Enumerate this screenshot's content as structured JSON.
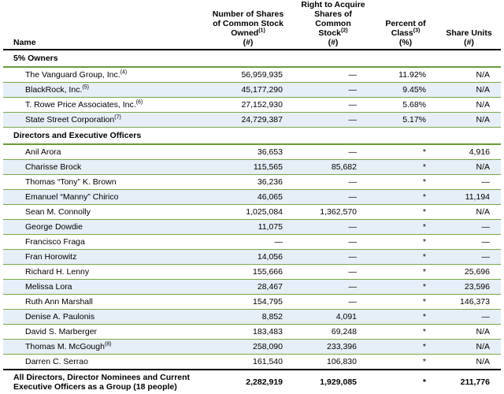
{
  "header": {
    "name": "Name",
    "shares_line1": "Number of Shares",
    "shares_line2": "of Common Stock",
    "shares_line3": "Owned",
    "shares_sup": "(1)",
    "shares_unit": "(#)",
    "right_line1": "Right to Acquire",
    "right_line2": "Shares of Common",
    "right_line3": "Stock",
    "right_sup": "(2)",
    "right_unit": "(#)",
    "pct_line1": "Percent of",
    "pct_line2": "Class",
    "pct_sup": "(3)",
    "pct_unit": "(%)",
    "units_line1": "Share Units",
    "units_unit": "(#)"
  },
  "sections": {
    "owners_title": "5% Owners",
    "directors_title": "Directors and Executive Officers"
  },
  "owners": [
    {
      "name": "The Vanguard Group, Inc.",
      "sup": "(4)",
      "shares": "56,959,935",
      "right": "—",
      "pct": "11.92%",
      "units": "N/A"
    },
    {
      "name": "BlackRock, Inc.",
      "sup": "(5)",
      "shares": "45,177,290",
      "right": "—",
      "pct": "9.45%",
      "units": "N/A"
    },
    {
      "name": "T. Rowe Price Associates, Inc.",
      "sup": "(6)",
      "shares": "27,152,930",
      "right": "—",
      "pct": "5.68%",
      "units": "N/A"
    },
    {
      "name": "State Street Corporation",
      "sup": "(7)",
      "shares": "24,729,387",
      "right": "—",
      "pct": "5.17%",
      "units": "N/A"
    }
  ],
  "directors": [
    {
      "name": "Anil Arora",
      "sup": "",
      "shares": "36,653",
      "right": "—",
      "pct": "*",
      "units": "4,916"
    },
    {
      "name": "Charisse Brock",
      "sup": "",
      "shares": "115,565",
      "right": "85,682",
      "pct": "*",
      "units": "N/A"
    },
    {
      "name": "Thomas “Tony” K. Brown",
      "sup": "",
      "shares": "36,236",
      "right": "—",
      "pct": "*",
      "units": "—"
    },
    {
      "name": "Emanuel “Manny” Chirico",
      "sup": "",
      "shares": "46,065",
      "right": "—",
      "pct": "*",
      "units": "11,194"
    },
    {
      "name": "Sean M. Connolly",
      "sup": "",
      "shares": "1,025,084",
      "right": "1,362,570",
      "pct": "*",
      "units": "N/A"
    },
    {
      "name": "George Dowdie",
      "sup": "",
      "shares": "11,075",
      "right": "—",
      "pct": "*",
      "units": "—"
    },
    {
      "name": "Francisco Fraga",
      "sup": "",
      "shares": "—",
      "right": "—",
      "pct": "*",
      "units": "—"
    },
    {
      "name": "Fran Horowitz",
      "sup": "",
      "shares": "14,056",
      "right": "—",
      "pct": "*",
      "units": "—"
    },
    {
      "name": "Richard H. Lenny",
      "sup": "",
      "shares": "155,666",
      "right": "—",
      "pct": "*",
      "units": "25,696"
    },
    {
      "name": "Melissa Lora",
      "sup": "",
      "shares": "28,467",
      "right": "—",
      "pct": "*",
      "units": "23,596"
    },
    {
      "name": "Ruth Ann Marshall",
      "sup": "",
      "shares": "154,795",
      "right": "—",
      "pct": "*",
      "units": "146,373"
    },
    {
      "name": "Denise A. Paulonis",
      "sup": "",
      "shares": "8,852",
      "right": "4,091",
      "pct": "*",
      "units": "—"
    },
    {
      "name": "David S. Marberger",
      "sup": "",
      "shares": "183,483",
      "right": "69,248",
      "pct": "*",
      "units": "N/A"
    },
    {
      "name": "Thomas M. McGough",
      "sup": "(8)",
      "shares": "258,090",
      "right": "233,396",
      "pct": "*",
      "units": "N/A"
    },
    {
      "name": "Darren C. Serrao",
      "sup": "",
      "shares": "161,540",
      "right": "106,830",
      "pct": "*",
      "units": "N/A"
    }
  ],
  "total": {
    "name_line1": "All Directors, Director Nominees and Current",
    "name_line2": "Executive Officers as a Group (18 people)",
    "shares": "2,282,919",
    "right": "1,929,085",
    "pct": "*",
    "units": "211,776"
  },
  "colors": {
    "row_shade": "#e6eef7",
    "row_rule": "#7aa84c",
    "section_rule": "#6a9b3c"
  }
}
